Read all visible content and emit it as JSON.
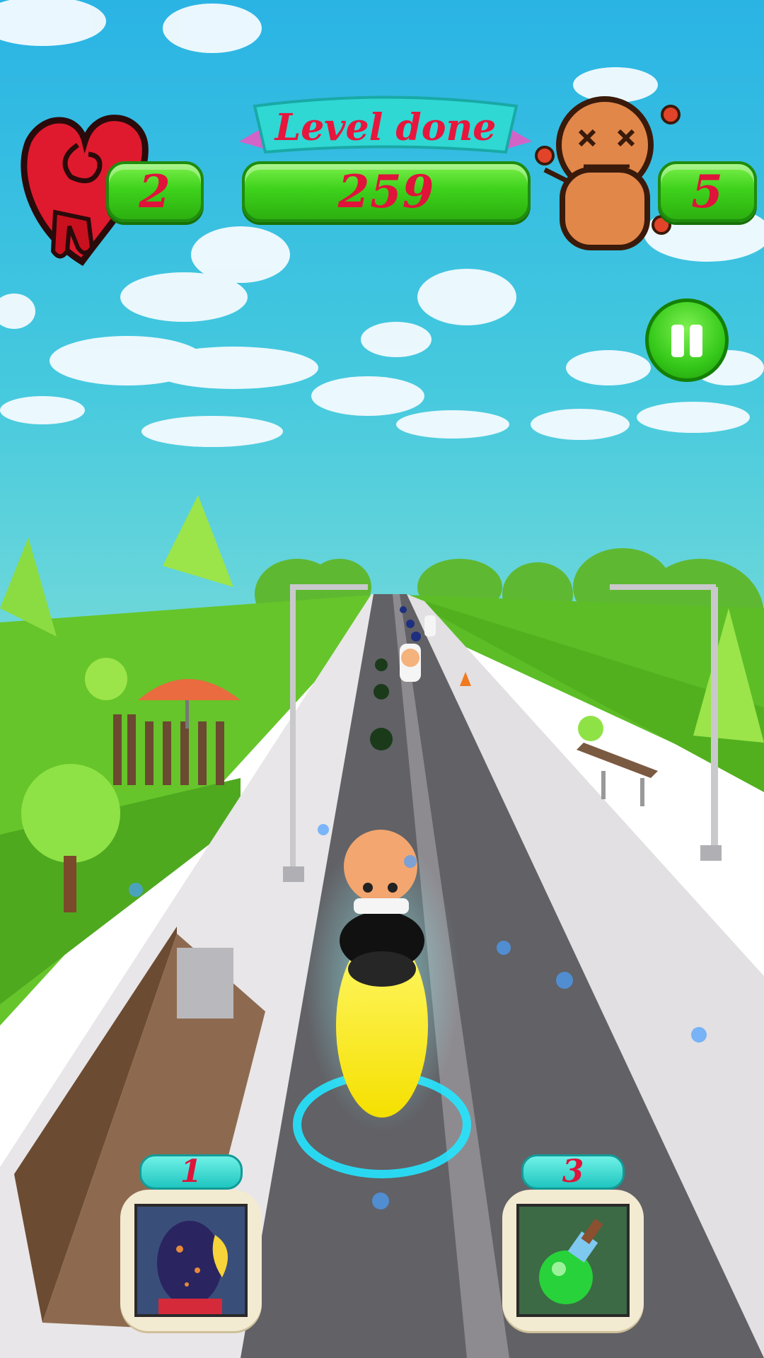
{
  "hud": {
    "lives": "2",
    "level_banner": "Level done",
    "level_progress": "259",
    "enemies": "5"
  },
  "powerups": [
    {
      "count": "1",
      "icon": "dragon-egg-icon"
    },
    {
      "count": "3",
      "icon": "green-potion-icon"
    }
  ],
  "colors": {
    "sky_top": "#2fb9e6",
    "sky_bottom": "#56d3dd",
    "grass": "#62c62a",
    "road": "#5e5e62",
    "pill_green": "#3ed21c",
    "hud_text": "#e0133a",
    "banner_cyan": "#2fd8d3"
  }
}
